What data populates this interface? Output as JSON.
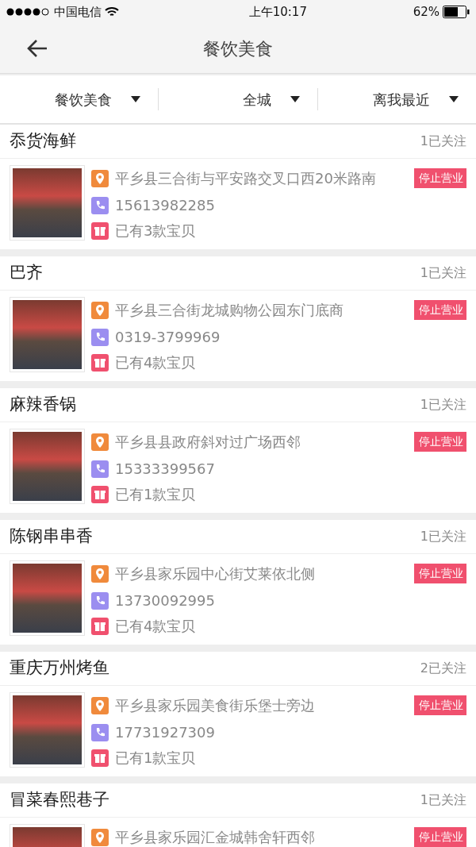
{
  "status_bar": {
    "carrier": "中国电信",
    "time": "上午10:17",
    "battery": "62%"
  },
  "nav": {
    "title": "餐饮美食"
  },
  "filters": [
    {
      "label": "餐饮美食"
    },
    {
      "label": "全城"
    },
    {
      "label": "离我最近"
    }
  ],
  "stores": [
    {
      "name": "忝货海鲜",
      "follows": "1已关注",
      "address": "平乡县三合街与平安路交叉口西20米路南",
      "phone": "15613982285",
      "items": "已有3款宝贝",
      "status": "停止营业"
    },
    {
      "name": "巴齐",
      "follows": "1已关注",
      "address": "平乡县三合街龙城购物公园东门底商",
      "phone": "0319-3799969",
      "items": "已有4款宝贝",
      "status": "停止营业"
    },
    {
      "name": "麻辣香锅",
      "follows": "1已关注",
      "address": "平乡县县政府斜对过广场西邻",
      "phone": "15333399567",
      "items": "已有1款宝贝",
      "status": "停止营业"
    },
    {
      "name": "陈钢串串香",
      "follows": "1已关注",
      "address": "平乡县家乐园中心街艾莱依北侧",
      "phone": "13730092995",
      "items": "已有4款宝贝",
      "status": "停止营业"
    },
    {
      "name": "重庆万州烤鱼",
      "follows": "2已关注",
      "address": "平乡县家乐园美食街乐堡士旁边",
      "phone": "17731927309",
      "items": "已有1款宝贝",
      "status": "停止营业"
    },
    {
      "name": "冒菜春熙巷子",
      "follows": "1已关注",
      "address": "平乡县家乐园汇金城韩舍轩西邻",
      "status": "停止营业"
    }
  ]
}
